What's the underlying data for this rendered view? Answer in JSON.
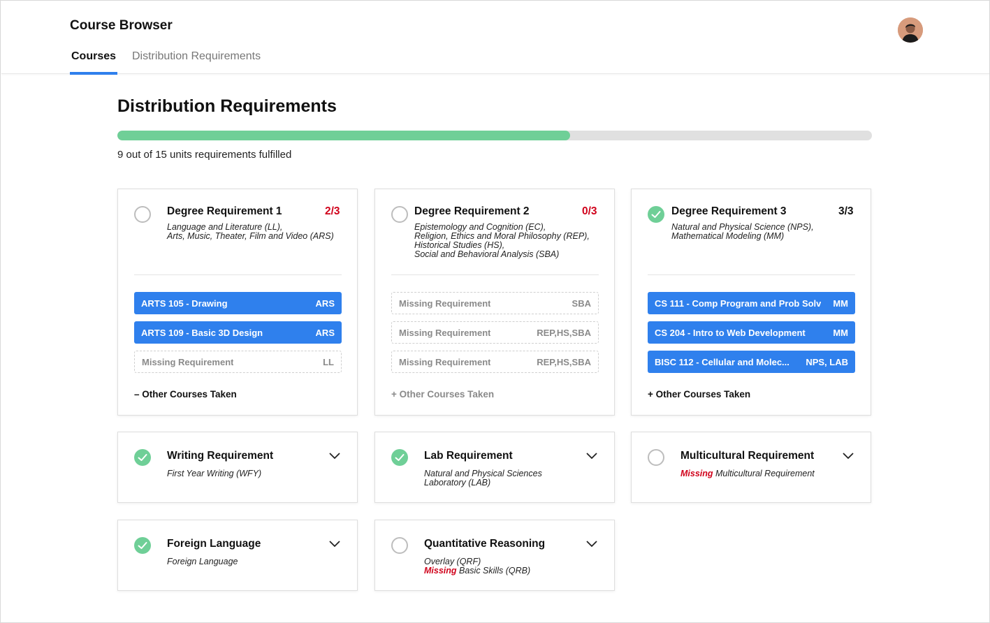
{
  "header": {
    "app_title": "Course Browser",
    "tabs": [
      {
        "label": "Courses",
        "active": true
      },
      {
        "label": "Distribution Requirements",
        "active": false
      }
    ]
  },
  "main": {
    "title": "Distribution Requirements",
    "progress": {
      "fulfilled": 9,
      "total": 15,
      "text": "9 out of 15 units requirements fulfilled"
    },
    "degree_requirements": [
      {
        "title": "Degree Requirement 1",
        "count": "2/3",
        "complete": false,
        "desc": "Language and Literature (LL),\nArts, Music, Theater, Film and Video (ARS)",
        "courses": [
          {
            "name": "ARTS 105 - Drawing",
            "code": "ARS",
            "missing": false
          },
          {
            "name": "ARTS 109 - Basic 3D Design",
            "code": "ARS",
            "missing": false
          },
          {
            "name": "Missing Requirement",
            "code": "LL",
            "missing": true
          }
        ],
        "other": "– Other Courses Taken"
      },
      {
        "title": "Degree Requirement 2",
        "count": "0/3",
        "complete": false,
        "desc": "Epistemology and Cognition (EC),\nReligion, Ethics and Moral Philosophy (REP),\nHistorical Studies (HS),\nSocial and Behavioral Analysis (SBA)",
        "courses": [
          {
            "name": "Missing Requirement",
            "code": "SBA",
            "missing": true
          },
          {
            "name": "Missing Requirement",
            "code": "REP,HS,SBA",
            "missing": true
          },
          {
            "name": "Missing Requirement",
            "code": "REP,HS,SBA",
            "missing": true
          }
        ],
        "other": "+ Other Courses Taken"
      },
      {
        "title": "Degree Requirement 3",
        "count": "3/3",
        "complete": true,
        "desc": "Natural and Physical Science (NPS),\nMathematical Modeling (MM)",
        "courses": [
          {
            "name": "CS 111 -  Comp Program and Prob Solv",
            "code": "MM",
            "missing": false
          },
          {
            "name": "CS 204 - Intro to Web Development",
            "code": "MM",
            "missing": false
          },
          {
            "name": "BISC 112 - Cellular and Molec...",
            "code": "NPS, LAB",
            "missing": false
          }
        ],
        "other": "+ Other Courses Taken"
      }
    ],
    "other_requirements": [
      {
        "title": "Writing Requirement",
        "complete": true,
        "desc": "First Year Writing (WFY)"
      },
      {
        "title": "Lab Requirement",
        "complete": true,
        "desc": "Natural and Physical Sciences\nLaboratory (LAB)"
      },
      {
        "title": "Multicultural Requirement",
        "complete": false,
        "missing_word": "Missing",
        "desc": " Multicultural Requirement"
      },
      {
        "title": "Foreign Language",
        "complete": true,
        "desc": "Foreign Language"
      },
      {
        "title": "Quantitative Reasoning",
        "complete": false,
        "desc": "Overlay (QRF)",
        "missing_word": "Missing",
        "desc2": " Basic Skills (QRB)"
      }
    ]
  },
  "colors": {
    "accent": "#2f80ed",
    "success": "#6fcf97",
    "danger": "#d0021b",
    "muted": "#8a8a8a"
  },
  "icons": {
    "status_done": "check-circle-icon",
    "status_empty": "empty-circle-icon",
    "expand": "chevron-down-icon",
    "avatar": "user-avatar"
  }
}
